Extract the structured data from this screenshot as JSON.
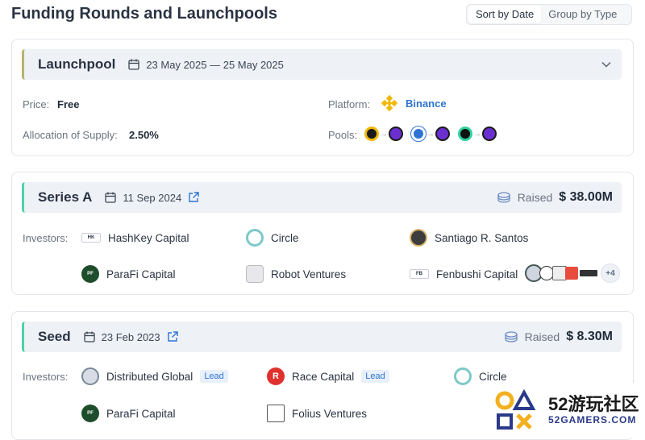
{
  "page": {
    "title": "Funding Rounds and Launchpools"
  },
  "sort_toggle": {
    "options": [
      "Sort by Date",
      "Group by Type"
    ],
    "active": "Sort by Date"
  },
  "launchpool": {
    "title": "Launchpool",
    "date": "23 May 2025 — 25 May 2025",
    "price_label": "Price:",
    "price_value": "Free",
    "allocation_label": "Allocation of Supply:",
    "allocation_value": "2.50%",
    "platform_label": "Platform:",
    "platform_value": "Binance",
    "pools_label": "Pools:"
  },
  "series_a": {
    "title": "Series A",
    "date": "11 Sep 2024",
    "raised_label": "Raised",
    "raised_amount": "$ 38.00M",
    "investors_label": "Investors:",
    "investors": [
      "HashKey Capital",
      "Circle",
      "Santiago R. Santos",
      "ParaFi Capital",
      "Robot Ventures",
      "Fenbushi Capital"
    ],
    "more_count": "+4"
  },
  "seed": {
    "title": "Seed",
    "date": "23 Feb 2023",
    "raised_label": "Raised",
    "raised_amount": "$ 8.30M",
    "investors_label": "Investors:",
    "investors": [
      "Distributed Global",
      "Race Capital",
      "Circle",
      "ParaFi Capital",
      "Folius Ventures"
    ],
    "lead_label": "Lead"
  },
  "watermark": {
    "brand": "52游玩社区",
    "site": "52GAMERS.COM"
  },
  "colors": {
    "accent_link": "#2d74d3",
    "launchpool_bar": "#b8b26f",
    "round_bar": "#4fd1a8",
    "binance": "#f0b90b"
  }
}
